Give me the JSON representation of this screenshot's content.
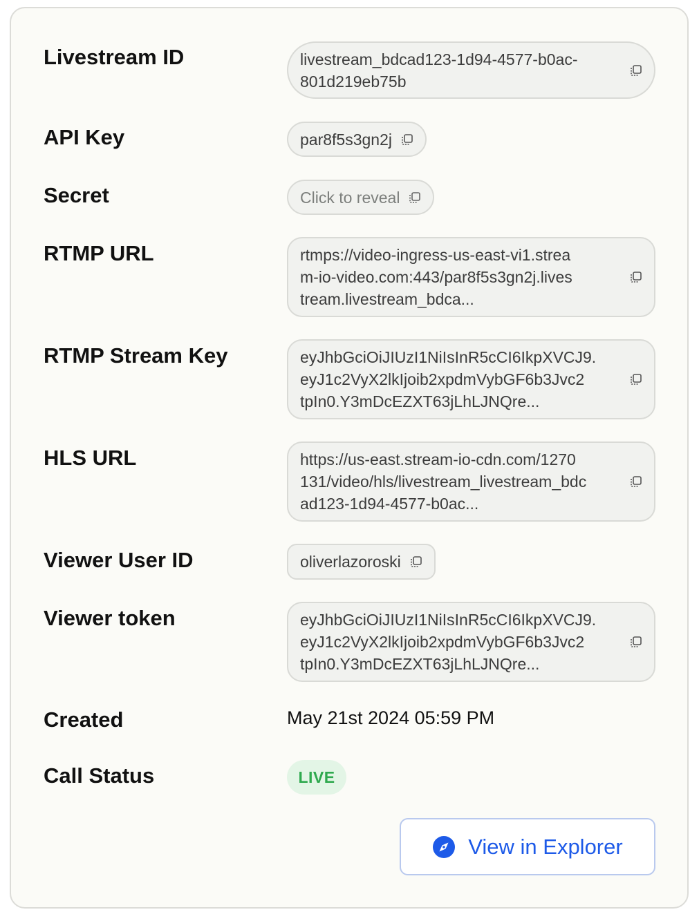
{
  "rows": {
    "livestream_id": {
      "label": "Livestream ID",
      "value": "livestream_bdcad123-1d94-4577-b0ac-\n801d219eb75b"
    },
    "api_key": {
      "label": "API Key",
      "value": "par8f5s3gn2j"
    },
    "secret": {
      "label": "Secret",
      "value": "Click to reveal"
    },
    "rtmp_url": {
      "label": "RTMP URL",
      "value": "rtmps://video-ingress-us-east-vi1.strea\nm-io-video.com:443/par8f5s3gn2j.lives\ntream.livestream_bdca..."
    },
    "rtmp_stream_key": {
      "label": "RTMP Stream Key",
      "value": "eyJhbGciOiJIUzI1NiIsInR5cCI6IkpXVCJ9.\neyJ1c2VyX2lkIjoib2xpdmVybGF6b3Jvc2\ntpIn0.Y3mDcEZXT63jLhLJNQre..."
    },
    "hls_url": {
      "label": "HLS URL",
      "value": "https://us-east.stream-io-cdn.com/1270\n131/video/hls/livestream_livestream_bdc\nad123-1d94-4577-b0ac..."
    },
    "viewer_user_id": {
      "label": "Viewer User ID",
      "value": "oliverlazoroski"
    },
    "viewer_token": {
      "label": "Viewer token",
      "value": "eyJhbGciOiJIUzI1NiIsInR5cCI6IkpXVCJ9.\neyJ1c2VyX2lkIjoib2xpdmVybGF6b3Jvc2\ntpIn0.Y3mDcEZXT63jLhLJNQre..."
    },
    "created": {
      "label": "Created",
      "value": "May 21st 2024 05:59 PM"
    },
    "call_status": {
      "label": "Call Status",
      "value": "LIVE"
    }
  },
  "actions": {
    "view_in_explorer": "View in Explorer"
  },
  "icons": {
    "copy": "copy-icon",
    "explorer": "compass-icon"
  },
  "colors": {
    "live_text": "#2fa94e",
    "live_bg": "#e3f5e6",
    "accent": "#1d5ae8"
  }
}
